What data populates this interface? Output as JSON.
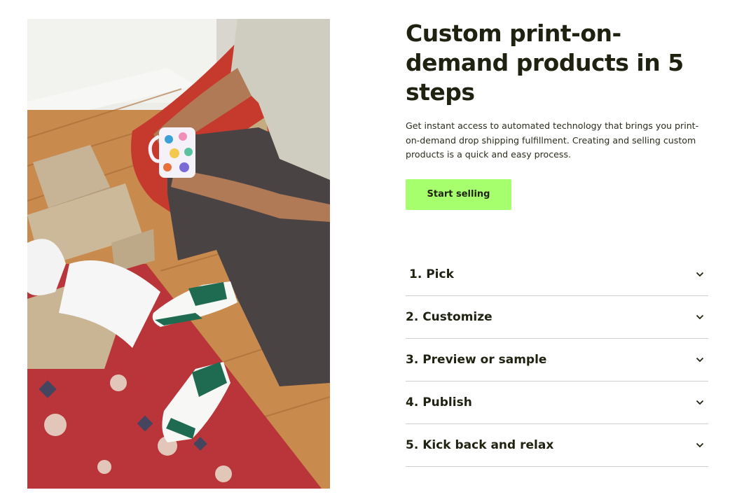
{
  "hero": {
    "title": "Custom print-on-demand products in 5 steps",
    "title_lines": [
      "Custom print-on-",
      "demand products in 5",
      "steps"
    ],
    "description": "Get instant access to automated technology that brings you print-on-demand drop shipping fulfillment. Creating and selling custom products is a quick and easy process.",
    "cta_label": "Start selling"
  },
  "steps": [
    {
      "label": "1. Pick",
      "icon": "chevron-down-icon"
    },
    {
      "label": "2. Customize",
      "icon": "chevron-down-icon"
    },
    {
      "label": "3. Preview or sample",
      "icon": "chevron-down-icon"
    },
    {
      "label": "4. Publish",
      "icon": "chevron-down-icon"
    },
    {
      "label": "5. Kick back and relax",
      "icon": "chevron-down-icon"
    }
  ],
  "colors": {
    "accent": "#a6ff6c",
    "text": "#1f2210",
    "divider": "#cfcfcf"
  }
}
